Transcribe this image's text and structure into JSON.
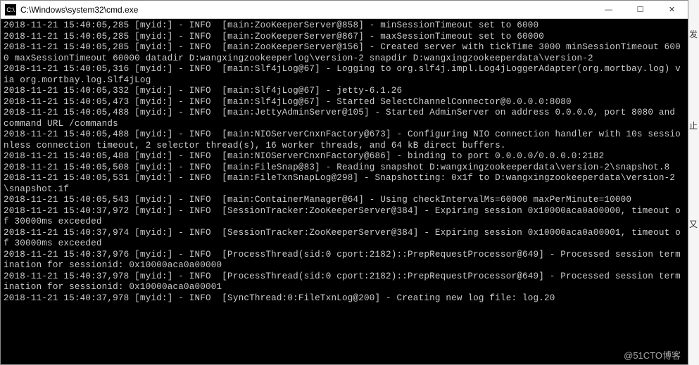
{
  "window": {
    "title": "C:\\Windows\\system32\\cmd.exe",
    "icon_label": "C:\\",
    "controls": {
      "minimize": "—",
      "maximize": "☐",
      "close": "✕"
    }
  },
  "log_lines": [
    "2018-11-21 15:40:05,285 [myid:] - INFO  [main:ZooKeeperServer@858] - minSessionTimeout set to 6000",
    "2018-11-21 15:40:05,285 [myid:] - INFO  [main:ZooKeeperServer@867] - maxSessionTimeout set to 60000",
    "2018-11-21 15:40:05,285 [myid:] - INFO  [main:ZooKeeperServer@156] - Created server with tickTime 3000 minSessionTimeout 6000 maxSessionTimeout 60000 datadir D:wangxingzookeeperlog\\version-2 snapdir D:wangxingzookeeperdata\\version-2",
    "2018-11-21 15:40:05,316 [myid:] - INFO  [main:Slf4jLog@67] - Logging to org.slf4j.impl.Log4jLoggerAdapter(org.mortbay.log) via org.mortbay.log.Slf4jLog",
    "2018-11-21 15:40:05,332 [myid:] - INFO  [main:Slf4jLog@67] - jetty-6.1.26",
    "2018-11-21 15:40:05,473 [myid:] - INFO  [main:Slf4jLog@67] - Started SelectChannelConnector@0.0.0.0:8080",
    "2018-11-21 15:40:05,488 [myid:] - INFO  [main:JettyAdminServer@105] - Started AdminServer on address 0.0.0.0, port 8080 and command URL /commands",
    "2018-11-21 15:40:05,488 [myid:] - INFO  [main:NIOServerCnxnFactory@673] - Configuring NIO connection handler with 10s sessionless connection timeout, 2 selector thread(s), 16 worker threads, and 64 kB direct buffers.",
    "2018-11-21 15:40:05,488 [myid:] - INFO  [main:NIOServerCnxnFactory@686] - binding to port 0.0.0.0/0.0.0.0:2182",
    "2018-11-21 15:40:05,508 [myid:] - INFO  [main:FileSnap@83] - Reading snapshot D:wangxingzookeeperdata\\version-2\\snapshot.8",
    "2018-11-21 15:40:05,531 [myid:] - INFO  [main:FileTxnSnapLog@298] - Snapshotting: 0x1f to D:wangxingzookeeperdata\\version-2\\snapshot.1f",
    "2018-11-21 15:40:05,543 [myid:] - INFO  [main:ContainerManager@64] - Using checkIntervalMs=60000 maxPerMinute=10000",
    "2018-11-21 15:40:37,972 [myid:] - INFO  [SessionTracker:ZooKeeperServer@384] - Expiring session 0x10000aca0a00000, timeout of 30000ms exceeded",
    "2018-11-21 15:40:37,974 [myid:] - INFO  [SessionTracker:ZooKeeperServer@384] - Expiring session 0x10000aca0a00001, timeout of 30000ms exceeded",
    "2018-11-21 15:40:37,976 [myid:] - INFO  [ProcessThread(sid:0 cport:2182)::PrepRequestProcessor@649] - Processed session termination for sessionid: 0x10000aca0a00000",
    "2018-11-21 15:40:37,978 [myid:] - INFO  [ProcessThread(sid:0 cport:2182)::PrepRequestProcessor@649] - Processed session termination for sessionid: 0x10000aca0a00001",
    "2018-11-21 15:40:37,978 [myid:] - INFO  [SyncThread:0:FileTxnLog@200] - Creating new log file: log.20"
  ],
  "watermark": "@51CTO博客",
  "side_chars": [
    "发",
    "止",
    "又"
  ]
}
